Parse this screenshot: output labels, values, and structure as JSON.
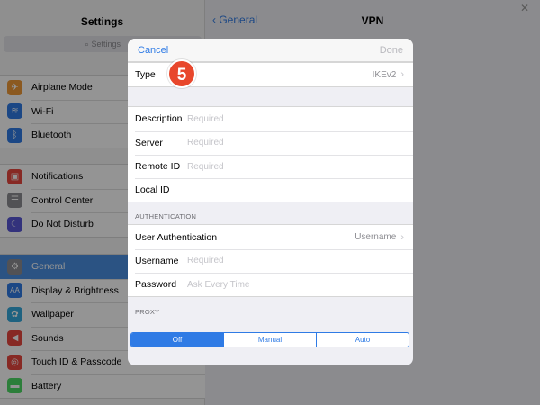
{
  "sidebar": {
    "title": "Settings",
    "search_placeholder": "Settings",
    "group1": [
      {
        "label": "Airplane Mode",
        "icon": "airplane-icon",
        "color": "#f09a37"
      },
      {
        "label": "Wi-Fi",
        "icon": "wifi-icon",
        "color": "#2f7be5"
      },
      {
        "label": "Bluetooth",
        "icon": "bluetooth-icon",
        "color": "#2f7be5"
      }
    ],
    "group2": [
      {
        "label": "Notifications",
        "icon": "notifications-icon",
        "color": "#e8473f"
      },
      {
        "label": "Control Center",
        "icon": "control-center-icon",
        "color": "#8e8e93"
      },
      {
        "label": "Do Not Disturb",
        "icon": "moon-icon",
        "color": "#5856d6"
      }
    ],
    "group3": [
      {
        "label": "General",
        "icon": "gear-icon",
        "color": "#8e8e93",
        "selected": true
      },
      {
        "label": "Display & Brightness",
        "icon": "display-icon",
        "color": "#2f7be5"
      },
      {
        "label": "Wallpaper",
        "icon": "wallpaper-icon",
        "color": "#35aadc"
      },
      {
        "label": "Sounds",
        "icon": "sounds-icon",
        "color": "#e8473f"
      },
      {
        "label": "Touch ID & Passcode",
        "icon": "fingerprint-icon",
        "color": "#e8473f"
      },
      {
        "label": "Battery",
        "icon": "battery-icon",
        "color": "#4cd964"
      }
    ]
  },
  "detail": {
    "back_label": "General",
    "title": "VPN"
  },
  "modal": {
    "cancel_label": "Cancel",
    "done_label": "Done",
    "type_label": "Type",
    "type_value": "IKEv2",
    "fields": [
      {
        "label": "Description",
        "placeholder": "Required"
      },
      {
        "label": "Server",
        "placeholder": "Required"
      },
      {
        "label": "Remote ID",
        "placeholder": "Required"
      },
      {
        "label": "Local ID",
        "placeholder": ""
      }
    ],
    "auth_section": "AUTHENTICATION",
    "user_auth_label": "User Authentication",
    "user_auth_value": "Username",
    "username_label": "Username",
    "username_placeholder": "Required",
    "password_label": "Password",
    "password_placeholder": "Ask Every Time",
    "proxy_section": "PROXY",
    "proxy_options": [
      "Off",
      "Manual",
      "Auto"
    ],
    "proxy_selected": "Off"
  },
  "step_badge": "5",
  "colors": {
    "accent": "#2f7be5",
    "badge": "#e8472c",
    "selected_row": "#4a90e2"
  }
}
